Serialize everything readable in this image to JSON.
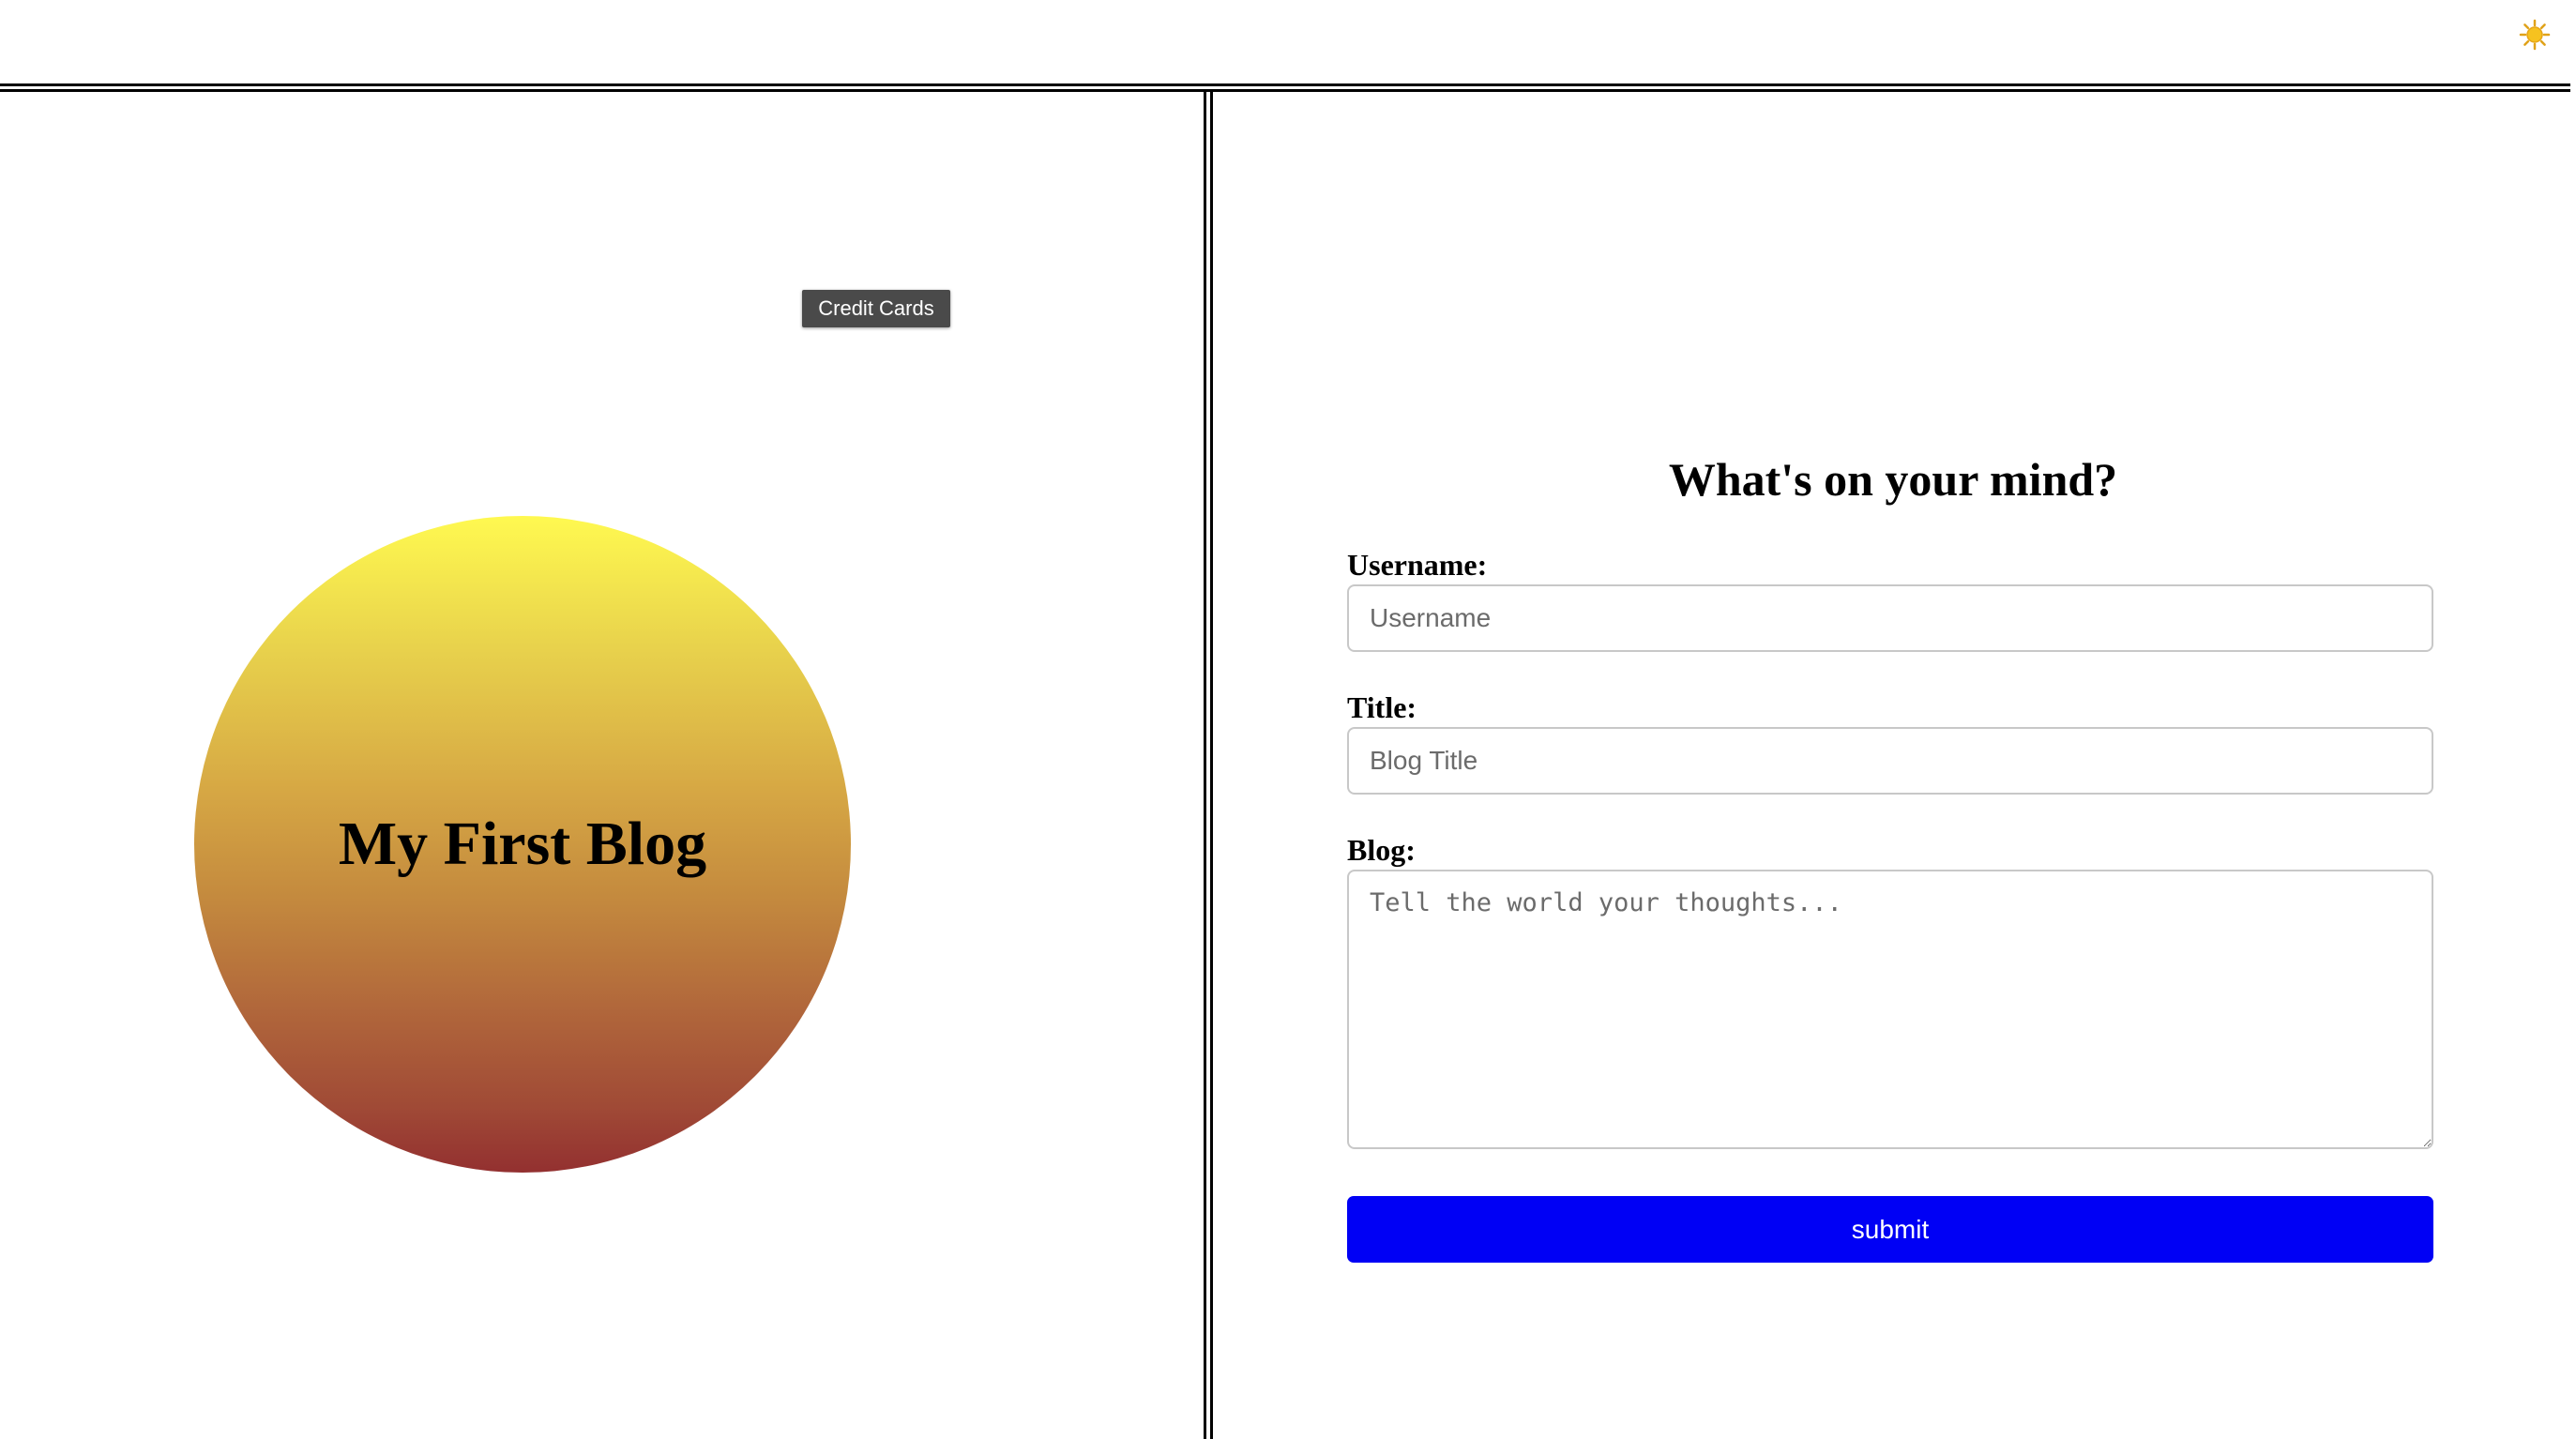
{
  "header": {
    "theme_toggle_icon": "sun-icon",
    "theme_toggle_glyph": "☀️"
  },
  "left": {
    "tooltip": "Credit Cards",
    "blog_title": "My First Blog",
    "circle_gradient_top": "#fff950",
    "circle_gradient_bottom": "#933030"
  },
  "form": {
    "heading": "What's on your mind?",
    "username_label": "Username:",
    "username_placeholder": "Username",
    "username_value": "",
    "title_label": "Title:",
    "title_placeholder": "Blog Title",
    "title_value": "",
    "blog_label": "Blog:",
    "blog_placeholder": "Tell the world your thoughts...",
    "blog_value": "",
    "submit_label": "submit",
    "submit_color": "#0000f5"
  }
}
